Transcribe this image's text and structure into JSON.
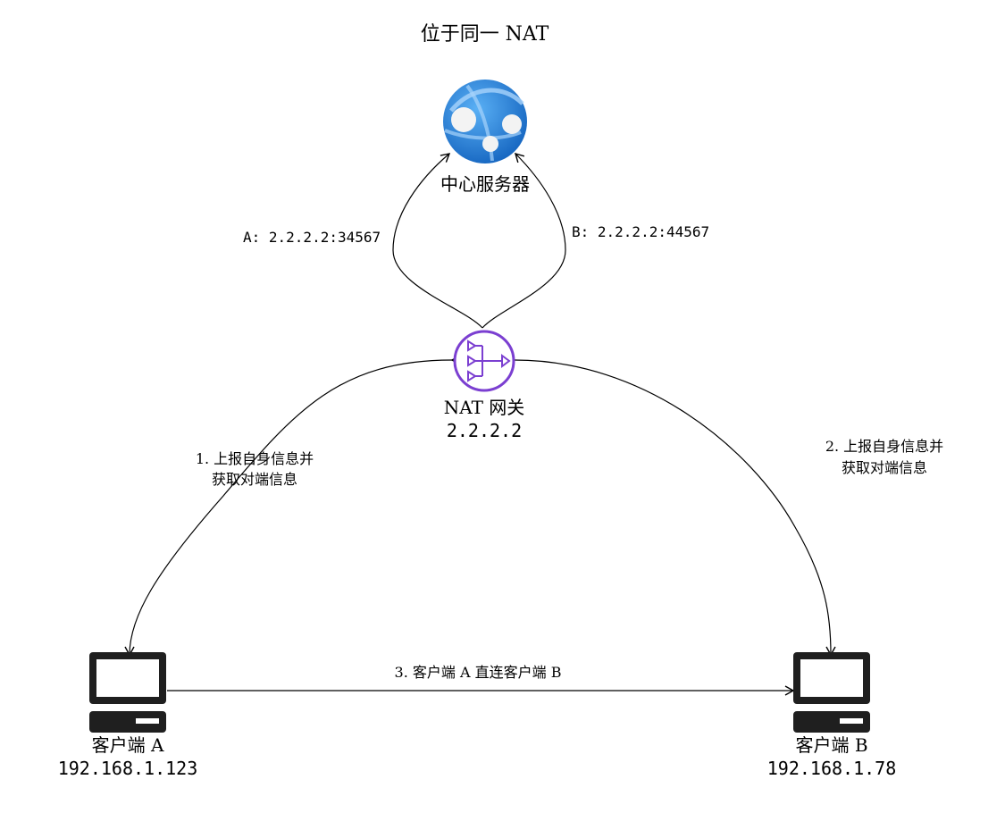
{
  "title": "位于同一 NAT",
  "server": {
    "label": "中心服务器",
    "icon": "web-app-globe-icon"
  },
  "nat": {
    "label": "NAT 网关",
    "ip": "2.2.2.2",
    "icon": "nat-gateway-icon",
    "color": "#7b3fd1"
  },
  "client_a": {
    "label": "客户端 A",
    "ip": "192.168.1.123",
    "icon": "desktop-computer-icon"
  },
  "client_b": {
    "label": "客户端 B",
    "ip": "192.168.1.78",
    "icon": "desktop-computer-icon"
  },
  "edges": {
    "a_to_server": "A: 2.2.2.2:34567",
    "b_to_server": "B: 2.2.2.2:44567",
    "step1_line1": "1. 上报自身信息并",
    "step1_line2": "获取对端信息",
    "step2_line1": "2. 上报自身信息并",
    "step2_line2": "获取对端信息",
    "step3": "3. 客户端 A 直连客户端 B"
  },
  "colors": {
    "server_blue": "#1e88e5",
    "server_light": "#64b5f6",
    "line": "#000000"
  }
}
